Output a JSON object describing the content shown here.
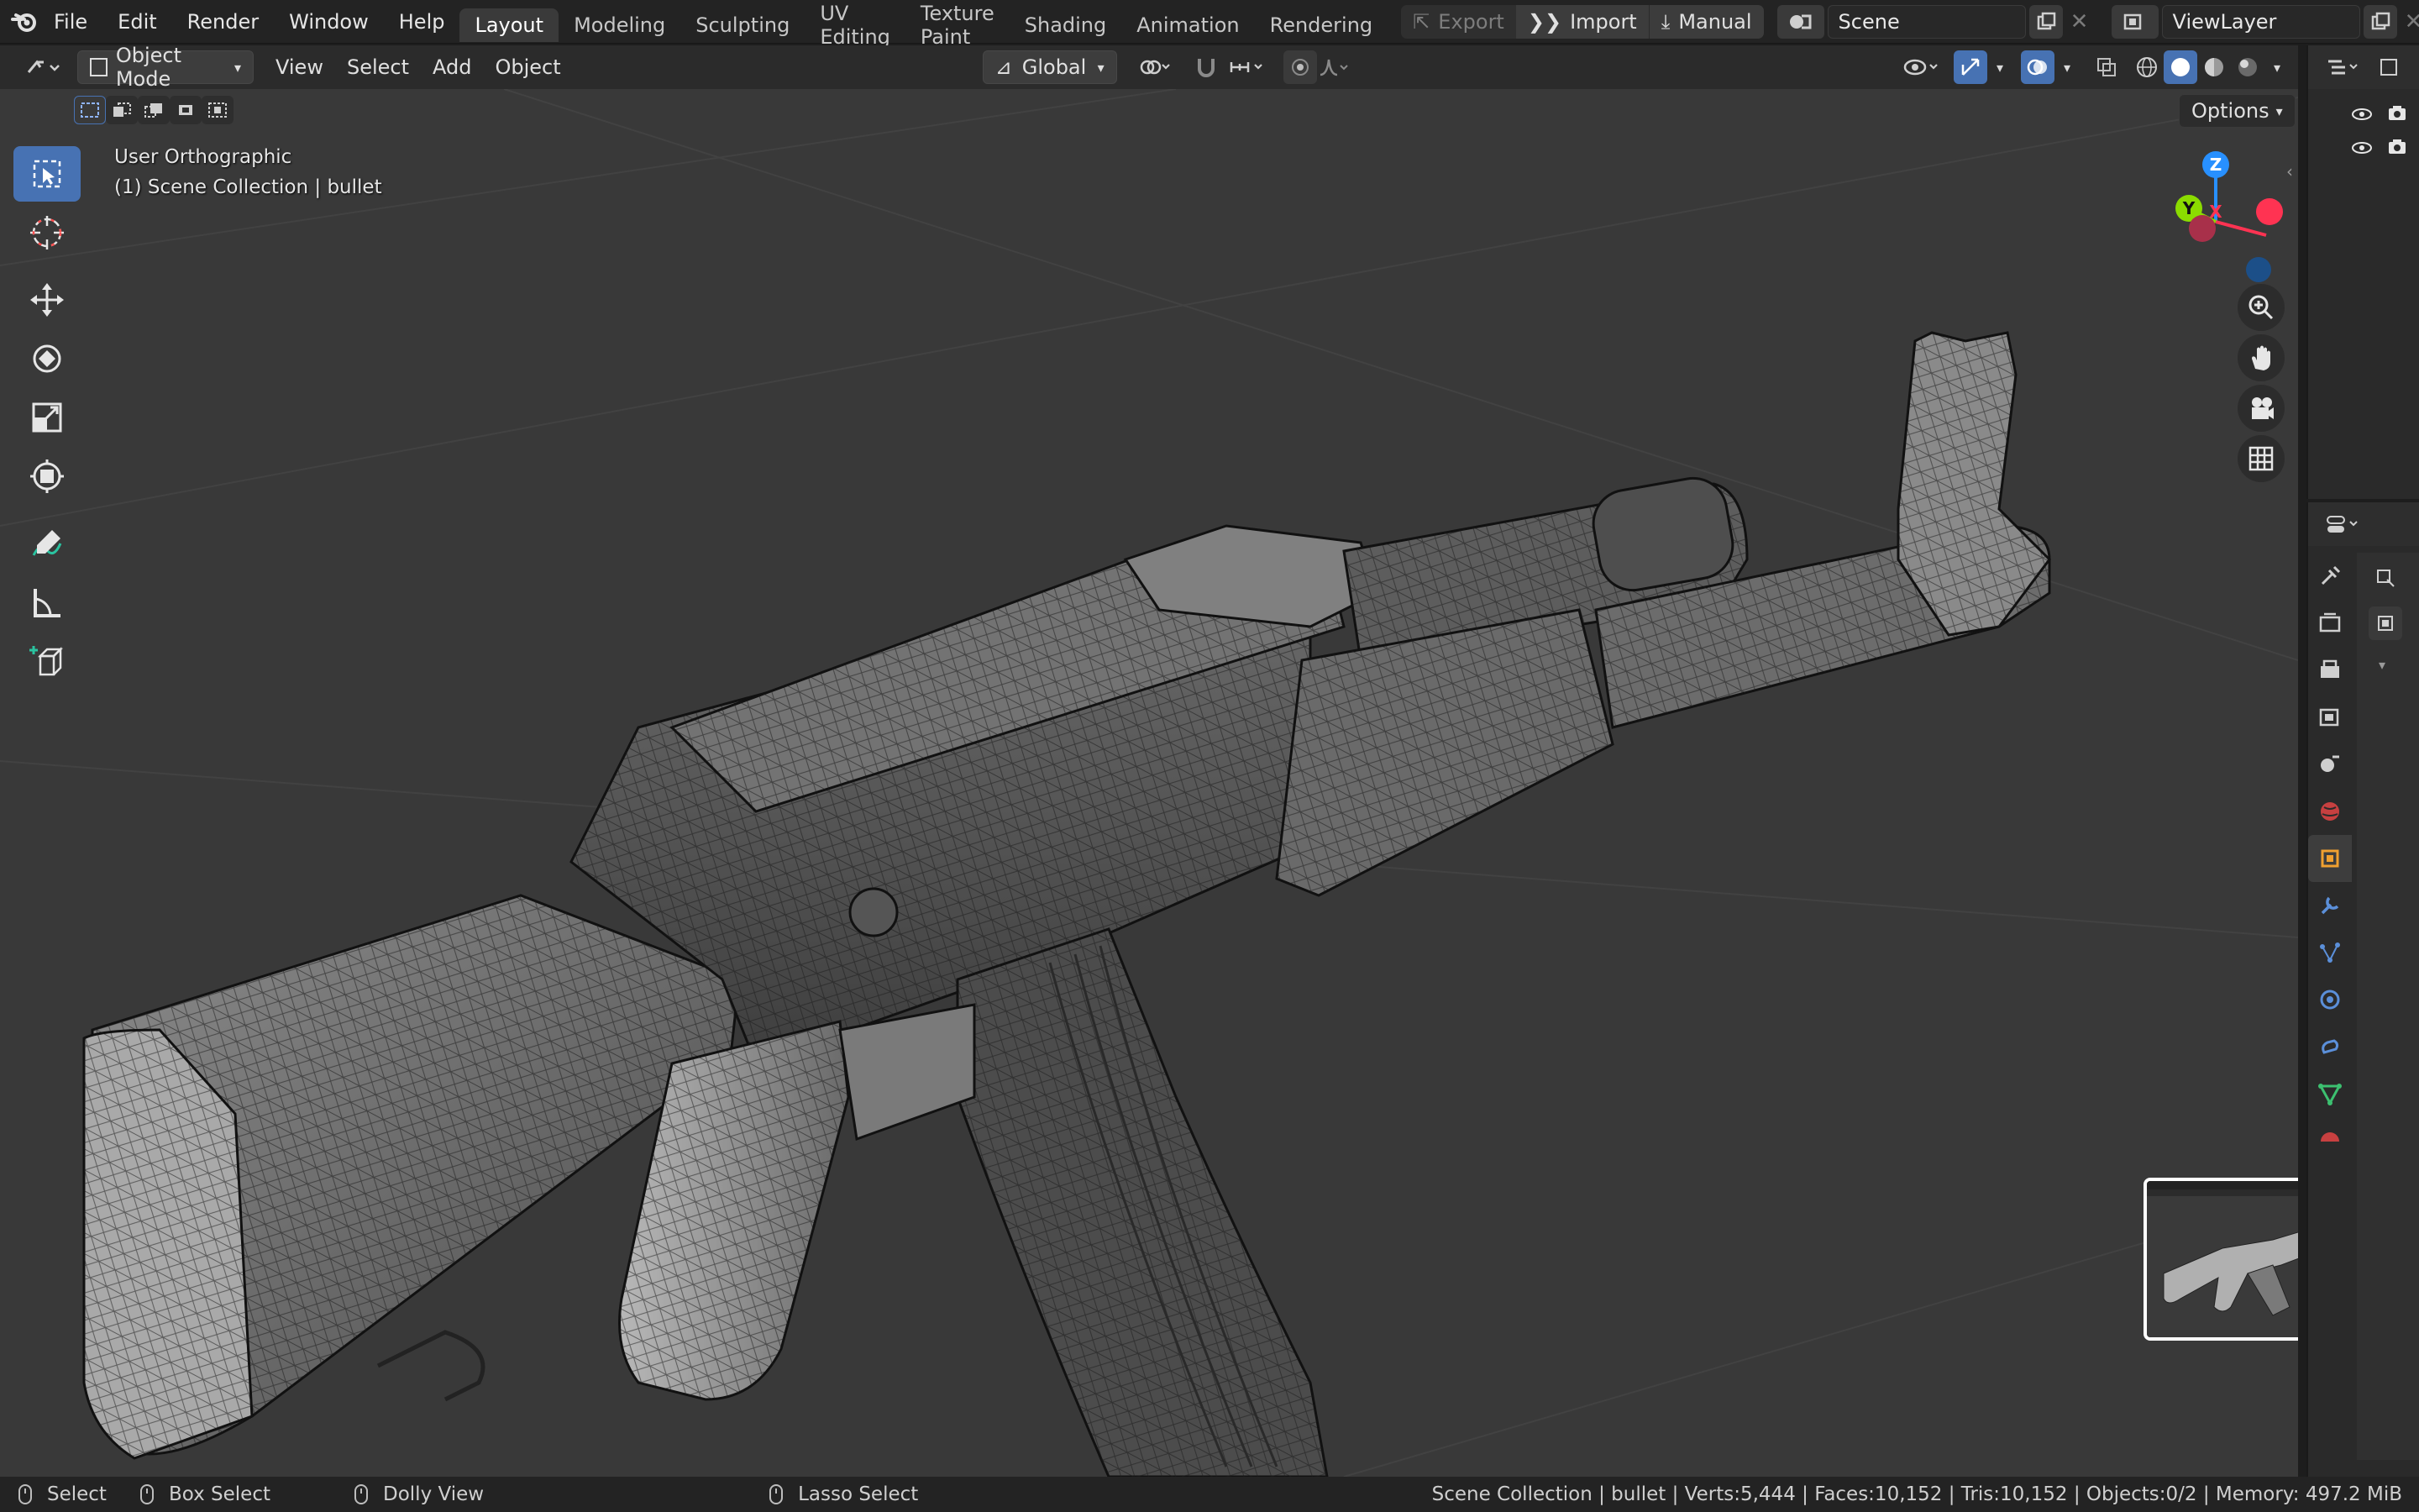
{
  "topbar": {
    "menus": [
      "File",
      "Edit",
      "Render",
      "Window",
      "Help"
    ],
    "workspaces": [
      "Layout",
      "Modeling",
      "Sculpting",
      "UV Editing",
      "Texture Paint",
      "Shading",
      "Animation",
      "Rendering"
    ],
    "active_workspace": "Layout",
    "export_label": "Export",
    "import_label": "Import",
    "manual_label": "Manual",
    "scene_name": "Scene",
    "view_layer_name": "ViewLayer"
  },
  "viewport_header": {
    "mode": "Object Mode",
    "menus": [
      "View",
      "Select",
      "Add",
      "Object"
    ],
    "orientation": "Global",
    "options_label": "Options"
  },
  "viewport": {
    "view_name": "User Orthographic",
    "collection_info": "(1) Scene Collection | bullet",
    "gizmo": {
      "z": "Z",
      "y": "Y",
      "x": "X"
    }
  },
  "statusbar": {
    "left_click": "Select",
    "drag": "Box Select",
    "middle": "Dolly View",
    "right": "Lasso Select",
    "stats": "Scene Collection | bullet | Verts:5,444 | Faces:10,152 | Tris:10,152 | Objects:0/2 | Memory: 497.2 MiB"
  },
  "colors": {
    "accent": "#4772b3",
    "axis_x": "#ff3352",
    "axis_y": "#8bdc00",
    "axis_z": "#2890ff",
    "viewport_bg": "#393939"
  }
}
